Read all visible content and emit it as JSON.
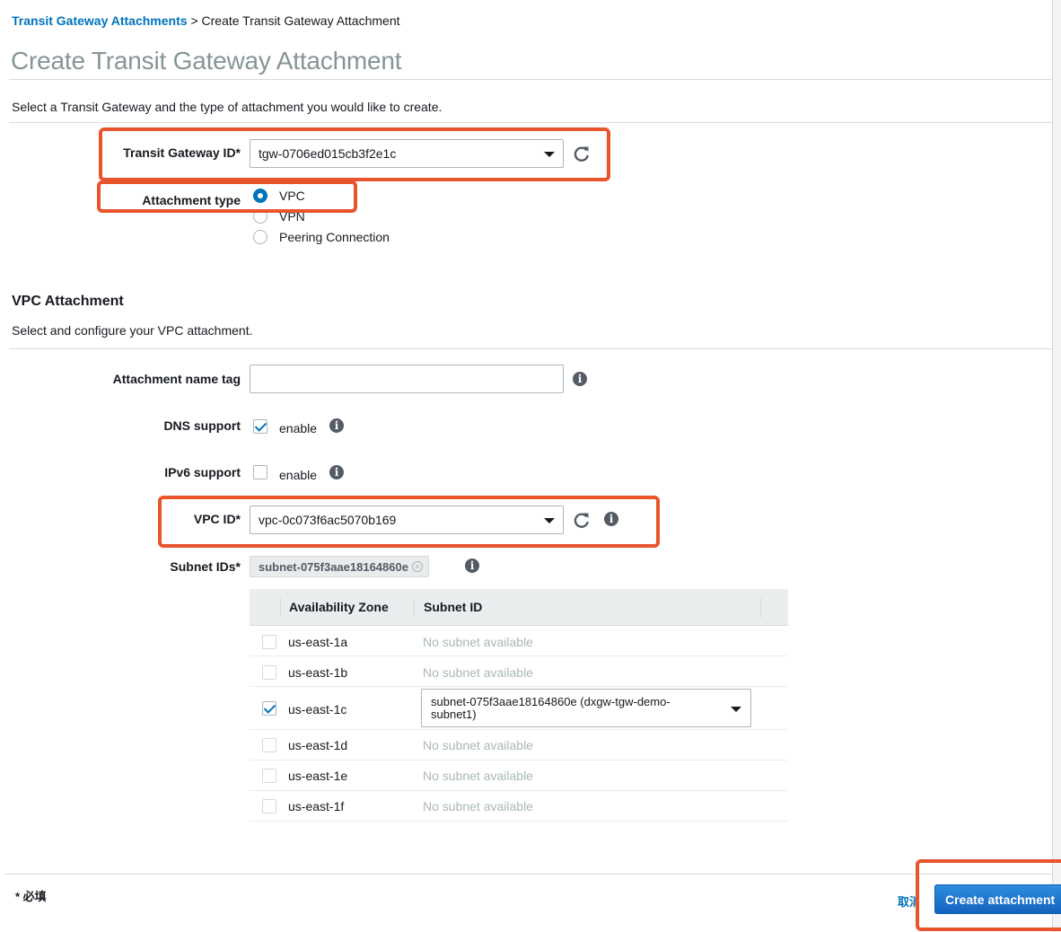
{
  "breadcrumb": {
    "link": "Transit Gateway Attachments",
    "separator": ">",
    "current": "Create Transit Gateway Attachment"
  },
  "page_title": "Create Transit Gateway Attachment",
  "intro": "Select a Transit Gateway and the type of attachment you would like to create.",
  "tgw": {
    "label": "Transit Gateway ID*",
    "value": "tgw-0706ed015cb3f2e1c"
  },
  "attachment_type": {
    "label": "Attachment type",
    "options": [
      "VPC",
      "VPN",
      "Peering Connection"
    ],
    "selected": "VPC"
  },
  "vpc_section": {
    "title": "VPC Attachment",
    "description": "Select and configure your VPC attachment.",
    "name_tag_label": "Attachment name tag",
    "name_tag_value": "",
    "dns_label": "DNS support",
    "dns_option": "enable",
    "dns_checked": true,
    "ipv6_label": "IPv6 support",
    "ipv6_option": "enable",
    "ipv6_checked": false,
    "vpc_label": "VPC ID*",
    "vpc_value": "vpc-0c073f6ac5070b169",
    "subnet_label": "Subnet IDs*",
    "subnet_token": "subnet-075f3aae18164860e"
  },
  "subnet_table": {
    "headers": [
      "Availability Zone",
      "Subnet ID"
    ],
    "rows": [
      {
        "az": "us-east-1a",
        "subnet": "No subnet available",
        "checked": false
      },
      {
        "az": "us-east-1b",
        "subnet": "No subnet available",
        "checked": false
      },
      {
        "az": "us-east-1c",
        "subnet": "subnet-075f3aae18164860e (dxgw-tgw-demo-subnet1)",
        "checked": true
      },
      {
        "az": "us-east-1d",
        "subnet": "No subnet available",
        "checked": false
      },
      {
        "az": "us-east-1e",
        "subnet": "No subnet available",
        "checked": false
      },
      {
        "az": "us-east-1f",
        "subnet": "No subnet available",
        "checked": false
      }
    ]
  },
  "footer": {
    "required_note": "* 必填",
    "cancel_label": "取消",
    "create_label": "Create attachment"
  },
  "colors": {
    "highlight": "#e8542b",
    "link": "#0073bb",
    "primary_button": "#0972d3"
  },
  "icons": {
    "refresh": "refresh-icon",
    "info": "info-icon",
    "dropdown": "chevron-down-icon",
    "remove_token": "close-icon"
  }
}
